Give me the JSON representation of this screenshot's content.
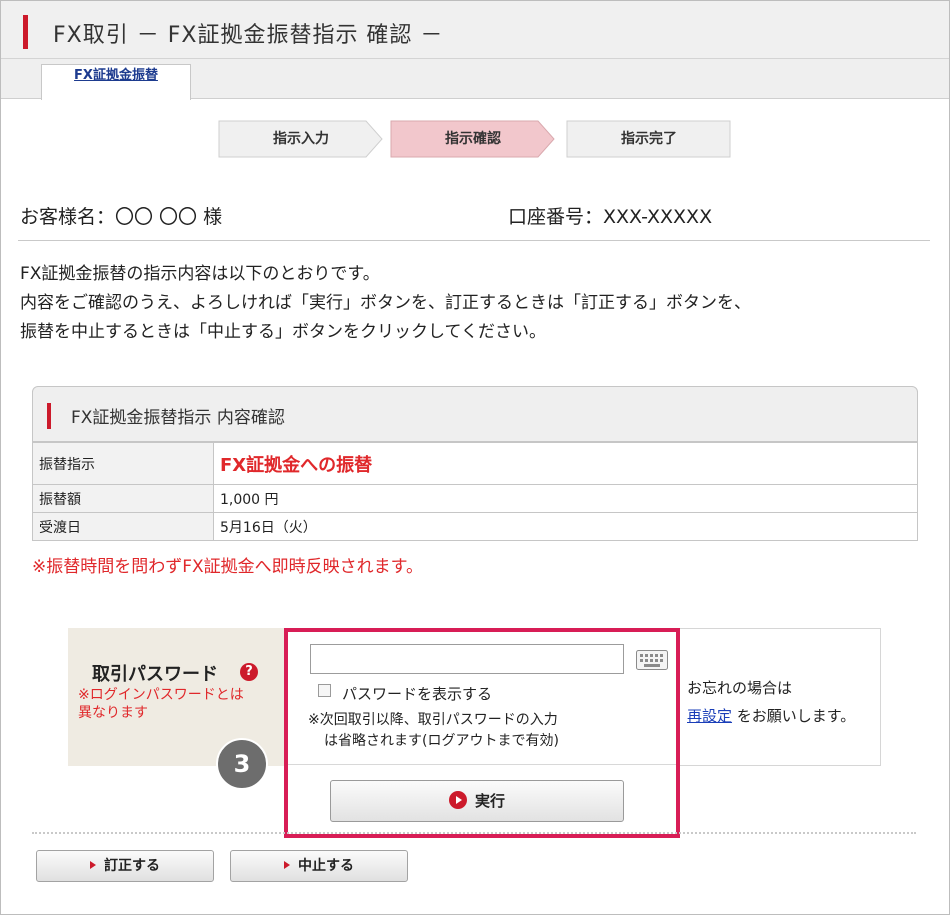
{
  "header": {
    "title": "FX取引 － FX証拠金振替指示 確認 －"
  },
  "tab": {
    "label": "FX証拠金振替"
  },
  "steps": [
    {
      "label": "指示入力",
      "active": false
    },
    {
      "label": "指示確認",
      "active": true
    },
    {
      "label": "指示完了",
      "active": false
    }
  ],
  "customer": {
    "name": "お客様名：〇〇 〇〇 様",
    "account": "口座番号：XXX-XXXXX"
  },
  "intro": {
    "line1": "FX証拠金振替の指示内容は以下のとおりです。",
    "line2": "内容をご確認のうえ、よろしければ「実行」ボタンを、訂正するときは「訂正する」ボタンを、",
    "line3": "振替を中止するときは「中止する」ボタンをクリックしてください。"
  },
  "panel": {
    "title": "FX証拠金振替指示 内容確認",
    "rows": [
      {
        "label": "振替指示",
        "value": "FX証拠金への振替"
      },
      {
        "label": "振替額",
        "value": "1,000 円"
      },
      {
        "label": "受渡日",
        "value": "5月16日（火）"
      }
    ],
    "notice": "※振替時間を問わずFX証拠金へ即時反映されます。"
  },
  "password": {
    "label": "取引パスワード",
    "help_icon": "?",
    "note_line1": "※ログインパスワードとは",
    "note_line2": "異なります",
    "input_value": "",
    "input_placeholder": "",
    "show_password_label": "パスワードを表示する",
    "save_note_line1": "※次回取引以降、取引パスワードの入力",
    "save_note_line2": "は省略されます(ログアウトまで有効)",
    "forgot_prefix": "お忘れの場合は",
    "forgot_link": "再設定",
    "forgot_suffix": " をお願いします。",
    "execute_label": "実行",
    "step_marker": "3"
  },
  "buttons": {
    "correct": "訂正する",
    "cancel": "中止する"
  },
  "colors": {
    "accent": "#cc1a2b",
    "highlight_border": "#d81d56",
    "notice_red": "#e0282b",
    "link_blue": "#1a3eb8"
  },
  "icons": {
    "keyboard": "keyboard-icon",
    "play": "play-icon",
    "triangle": "triangle-right-icon"
  }
}
